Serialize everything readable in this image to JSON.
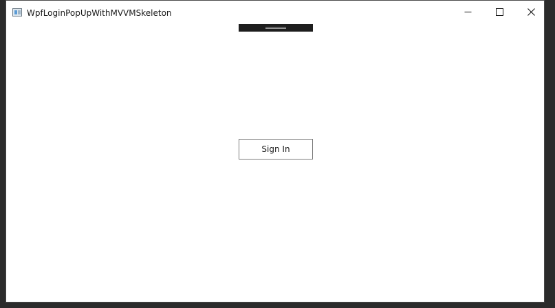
{
  "window": {
    "title": "WpfLoginPopUpWithMVVMSkeleton",
    "app_icon": "wpf-window-icon",
    "caption_buttons": {
      "minimize_icon": "minimize-icon",
      "maximize_icon": "maximize-icon",
      "close_icon": "close-icon"
    }
  },
  "main": {
    "drag_handle_icon": "drag-handle-icon",
    "sign_in_label": "Sign In"
  },
  "colors": {
    "window_background": "#ffffff",
    "frame": "#2b2b2b",
    "drag_handle": "#1e1e1e",
    "button_border": "#7a7a7a"
  }
}
